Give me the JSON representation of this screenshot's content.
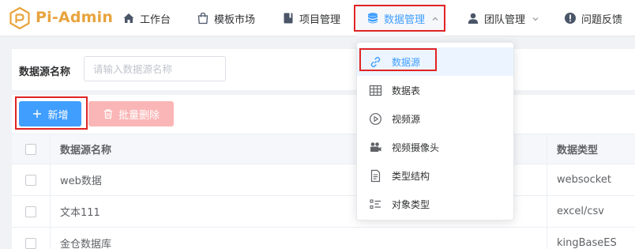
{
  "app": {
    "brand": "Pi-Admin",
    "brand_color": "#e8a33d"
  },
  "nav": {
    "workbench": "工作台",
    "template_market": "模板市场",
    "project_mgmt": "项目管理",
    "data_mgmt": "数据管理",
    "team_mgmt": "团队管理",
    "feedback": "问题反馈"
  },
  "search": {
    "label": "数据源名称",
    "placeholder": "请输入数据源名称",
    "value": ""
  },
  "toolbar": {
    "add_label": "新增",
    "batch_delete_label": "批量删除"
  },
  "table": {
    "headers": {
      "name": "数据源名称",
      "type": "数据类型"
    },
    "rows": [
      {
        "name": "web数据",
        "type": "websocket"
      },
      {
        "name": "文本111",
        "type": "excel/csv"
      },
      {
        "name": "金仓数据库",
        "type": "kingBaseES"
      }
    ]
  },
  "dropdown": {
    "items": [
      {
        "label": "数据源",
        "icon": "link-icon",
        "active": true
      },
      {
        "label": "数据表",
        "icon": "table-icon"
      },
      {
        "label": "视频源",
        "icon": "play-circle-icon"
      },
      {
        "label": "视频摄像头",
        "icon": "video-camera-icon"
      },
      {
        "label": "类型结构",
        "icon": "document-icon"
      },
      {
        "label": "对象类型",
        "icon": "list-icon"
      }
    ]
  },
  "colors": {
    "primary": "#409eff",
    "danger_light": "#fab6b6",
    "highlight_border": "#e02424"
  }
}
